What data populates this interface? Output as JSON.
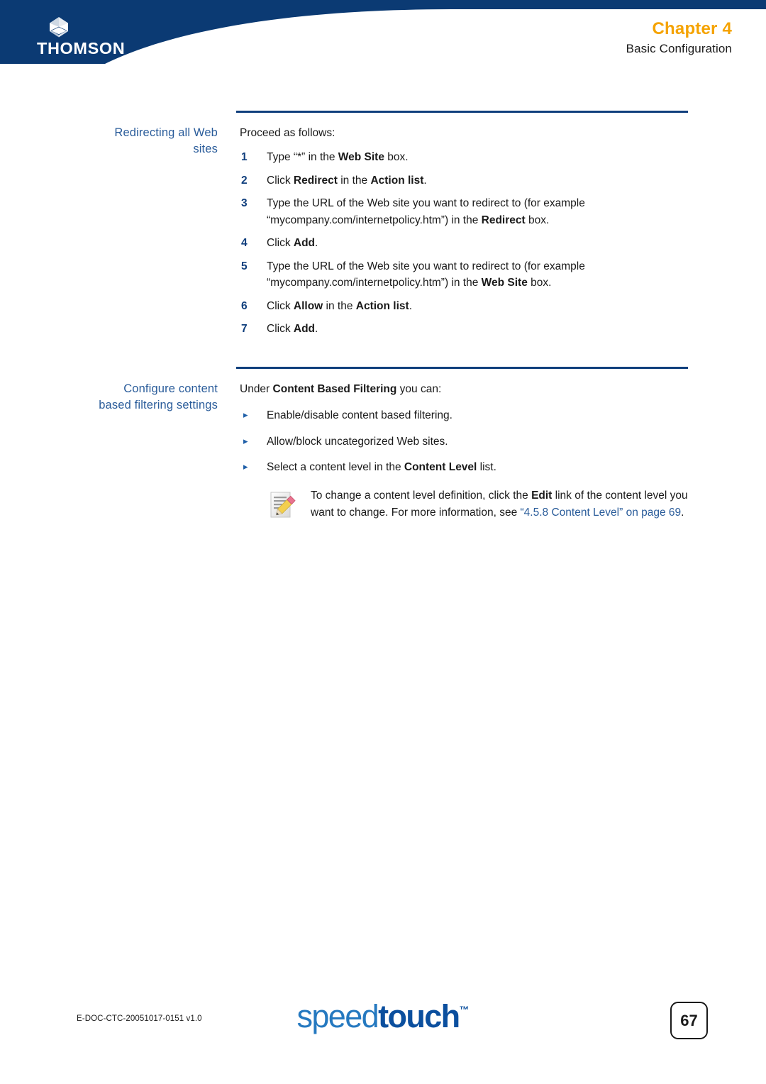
{
  "header": {
    "brand": "THOMSON",
    "brand_logo_icon": "thomson-diamond-icon",
    "chapter": "Chapter 4",
    "chapter_subtitle": "Basic Configuration",
    "banner_color": "#0b3a73",
    "chapter_color": "#f5a300"
  },
  "sections": [
    {
      "heading_line1": "Redirecting all Web",
      "heading_line2": "sites",
      "intro": "Proceed as follows:",
      "steps": [
        {
          "num": "1",
          "parts": [
            {
              "t": "Type “*” in the ",
              "b": false
            },
            {
              "t": "Web Site",
              "b": true
            },
            {
              "t": " box.",
              "b": false
            }
          ]
        },
        {
          "num": "2",
          "parts": [
            {
              "t": "Click ",
              "b": false
            },
            {
              "t": "Redirect",
              "b": true
            },
            {
              "t": " in the ",
              "b": false
            },
            {
              "t": "Action list",
              "b": true
            },
            {
              "t": ".",
              "b": false
            }
          ]
        },
        {
          "num": "3",
          "parts": [
            {
              "t": "Type the URL of the Web site you want to redirect to (for example “mycompany.com/internetpolicy.htm”) in the ",
              "b": false
            },
            {
              "t": "Redirect",
              "b": true
            },
            {
              "t": " box.",
              "b": false
            }
          ]
        },
        {
          "num": "4",
          "parts": [
            {
              "t": "Click ",
              "b": false
            },
            {
              "t": "Add",
              "b": true
            },
            {
              "t": ".",
              "b": false
            }
          ]
        },
        {
          "num": "5",
          "parts": [
            {
              "t": "Type the URL of the Web site you want to redirect to (for example “mycompany.com/internetpolicy.htm”) in the ",
              "b": false
            },
            {
              "t": "Web Site",
              "b": true
            },
            {
              "t": " box.",
              "b": false
            }
          ]
        },
        {
          "num": "6",
          "parts": [
            {
              "t": "Click ",
              "b": false
            },
            {
              "t": "Allow",
              "b": true
            },
            {
              "t": " in the ",
              "b": false
            },
            {
              "t": "Action list",
              "b": true
            },
            {
              "t": ".",
              "b": false
            }
          ]
        },
        {
          "num": "7",
          "parts": [
            {
              "t": "Click ",
              "b": false
            },
            {
              "t": "Add",
              "b": true
            },
            {
              "t": ".",
              "b": false
            }
          ]
        }
      ]
    },
    {
      "heading_line1": "Configure content",
      "heading_line2": "based filtering settings",
      "intro_parts": [
        {
          "t": "Under ",
          "b": false
        },
        {
          "t": "Content Based Filtering",
          "b": true
        },
        {
          "t": " you can:",
          "b": false
        }
      ],
      "bullet_marker": "▸",
      "bullets": [
        {
          "parts": [
            {
              "t": "Enable/disable content based filtering.",
              "b": false
            }
          ]
        },
        {
          "parts": [
            {
              "t": "Allow/block uncategorized Web sites.",
              "b": false
            }
          ]
        },
        {
          "parts": [
            {
              "t": "Select a content level in the ",
              "b": false
            },
            {
              "t": "Content Level",
              "b": true
            },
            {
              "t": " list.",
              "b": false
            }
          ]
        }
      ],
      "note": {
        "icon": "note-pencil-icon",
        "parts": [
          {
            "t": "To change a content level definition, click the ",
            "b": false,
            "link": false
          },
          {
            "t": "Edit",
            "b": true,
            "link": false
          },
          {
            "t": " link of the content level you want to change. For more information, see ",
            "b": false,
            "link": false
          },
          {
            "t": "“4.5.8 Content Level” on page 69",
            "b": false,
            "link": true
          },
          {
            "t": ".",
            "b": false,
            "link": false
          }
        ]
      }
    }
  ],
  "footer": {
    "doc_id": "E-DOC-CTC-20051017-0151 v1.0",
    "logo_part1": "speed",
    "logo_part2": "touch",
    "logo_tm": "™",
    "page_number": "67"
  }
}
